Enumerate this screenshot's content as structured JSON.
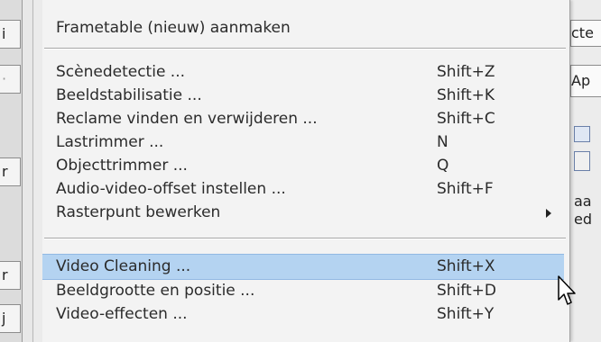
{
  "background": {
    "left_fragments": [
      "i",
      "·",
      "r",
      "r",
      "j"
    ],
    "right_fragments": {
      "top": "cte",
      "mid": "Ap",
      "line1": "aa",
      "line2": "ed"
    }
  },
  "menu": {
    "items": [
      {
        "label": "Frametable (nieuw) aanmaken",
        "shortcut": ""
      },
      {
        "label": "Scènedetectie ...",
        "shortcut": "Shift+Z"
      },
      {
        "label": "Beeldstabilisatie ...",
        "shortcut": "Shift+K"
      },
      {
        "label": "Reclame vinden en verwijderen ...",
        "shortcut": "Shift+C"
      },
      {
        "label": "Lastrimmer ...",
        "shortcut": "N"
      },
      {
        "label": "Objecttrimmer ...",
        "shortcut": "Q"
      },
      {
        "label": "Audio-video-offset instellen ...",
        "shortcut": "Shift+F"
      },
      {
        "label": "Rasterpunt bewerken",
        "shortcut": ""
      },
      {
        "label": "Video Cleaning ...",
        "shortcut": "Shift+X"
      },
      {
        "label": "Beeldgrootte en positie ...",
        "shortcut": "Shift+D"
      },
      {
        "label": "Video-effecten ...",
        "shortcut": "Shift+Y"
      }
    ],
    "highlight_color": "#b4d3f1",
    "submenu_arrow_icon": "chevron-right-icon",
    "cursor_icon": "mouse-pointer-icon"
  }
}
